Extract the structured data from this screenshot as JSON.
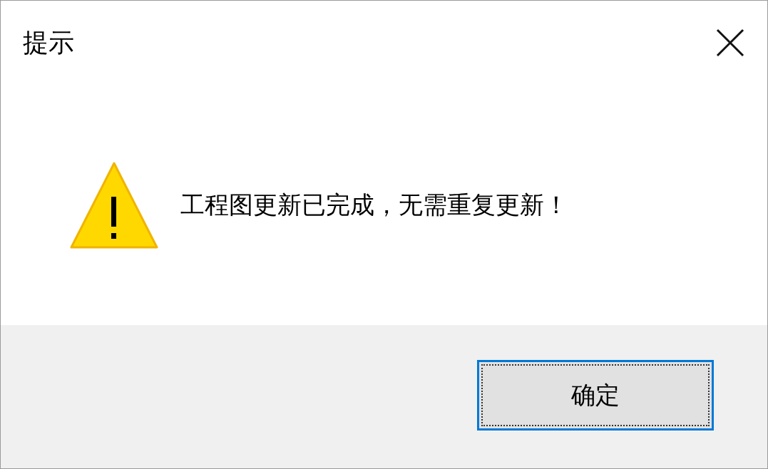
{
  "window": {
    "title": "提示"
  },
  "message": {
    "text": "工程图更新已完成，无需重复更新！"
  },
  "buttons": [
    {
      "label": "确定",
      "focused": true
    }
  ]
}
